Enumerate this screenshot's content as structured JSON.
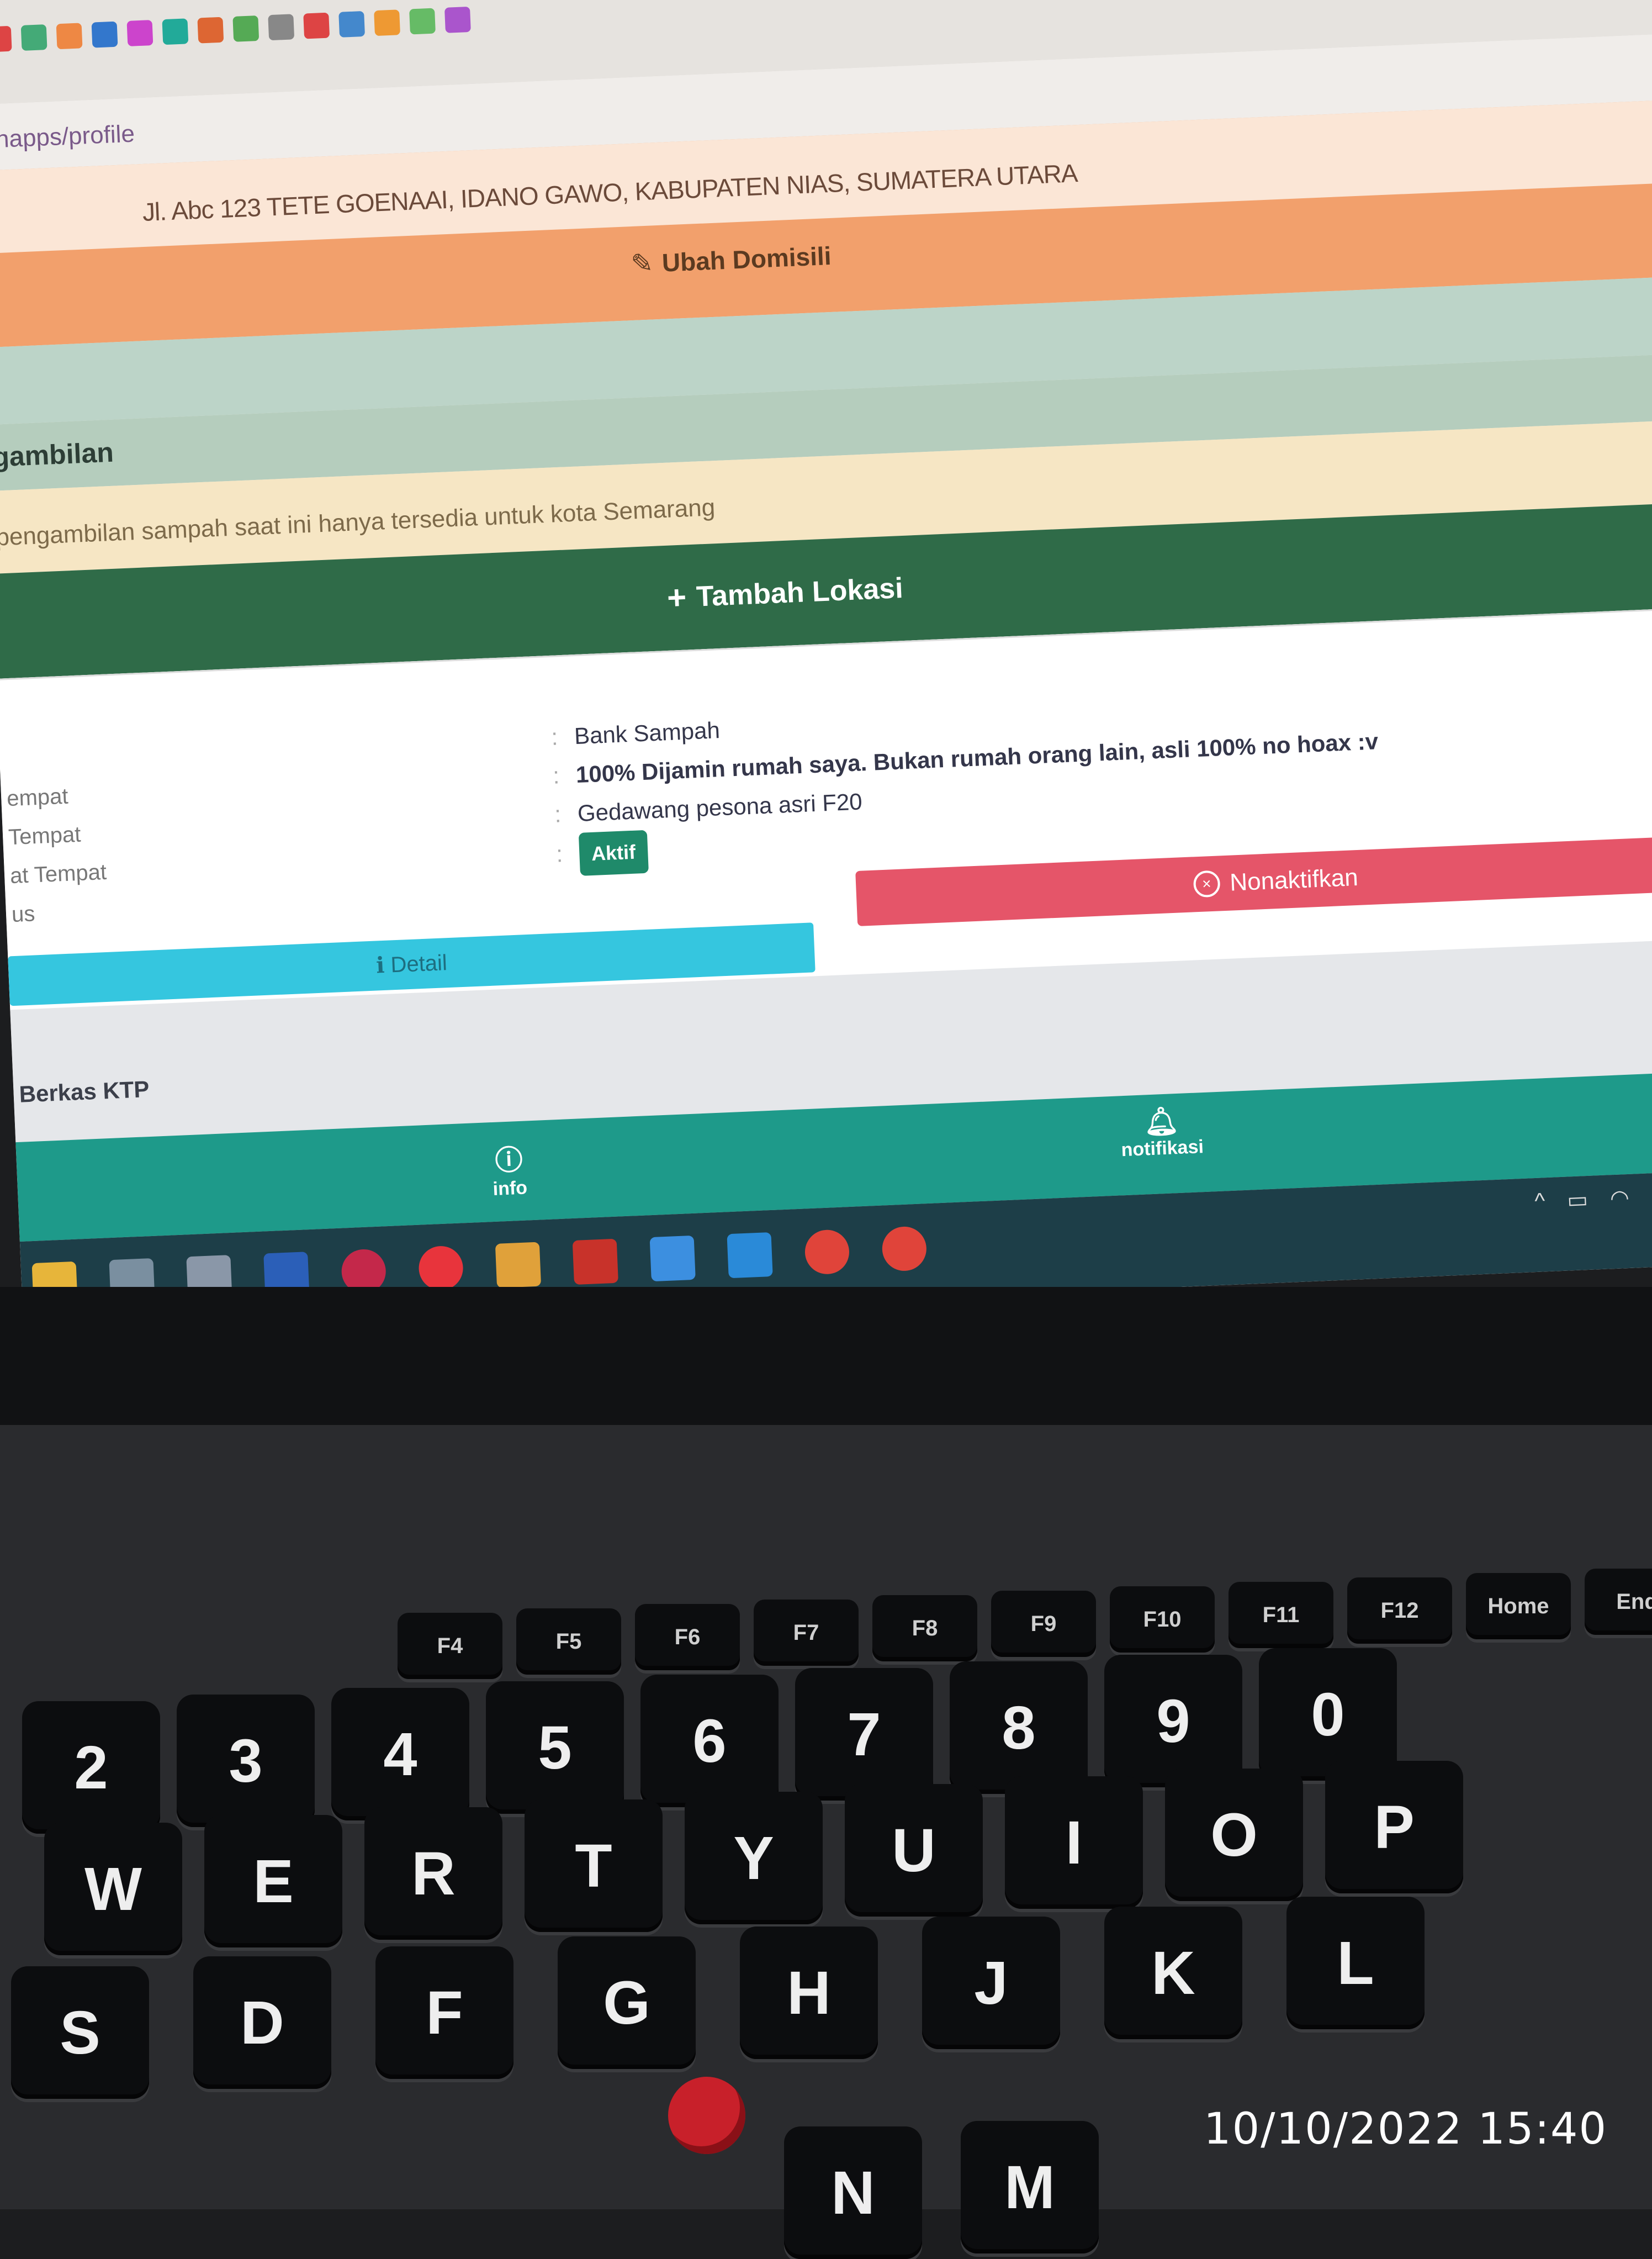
{
  "browser": {
    "address": "inapps/profile"
  },
  "domisili": {
    "address": "Jl. Abc 123 TETE GOENAAI, IDANO GAWO, KABUPATEN NIAS, SUMATERA UTARA",
    "edit_label": "Ubah Domisili"
  },
  "pengambilan": {
    "title": "gambilan",
    "notice": "pengambilan sampah saat ini hanya tersedia untuk kota Semarang",
    "add_label": "Tambah Lokasi"
  },
  "lokasi": {
    "labels": [
      "empat",
      "Tempat",
      "at Tempat",
      "us"
    ],
    "values": {
      "type": "Bank Sampah",
      "description": "100% Dijamin rumah saya. Bukan rumah orang lain, asli 100% no hoax :v",
      "address": "Gedawang pesona asri F20",
      "status": "Aktif"
    },
    "detail_label": "Detail",
    "deactivate_label": "Nonaktifkan"
  },
  "berkas": {
    "title": "Berkas KTP"
  },
  "bottom_nav": {
    "info": "info",
    "notifications": "notifikasi"
  },
  "keyboard": {
    "fn_row": [
      "F4",
      "F5",
      "F6",
      "F7",
      "F8",
      "F9",
      "F10",
      "F11",
      "F12",
      "Home",
      "End"
    ],
    "number_row": [
      "2",
      "3",
      "4",
      "5",
      "6",
      "7",
      "8",
      "9",
      "0"
    ],
    "top_row": [
      "W",
      "E",
      "R",
      "T",
      "Y",
      "U",
      "I",
      "O",
      "P"
    ],
    "home_row": [
      "S",
      "D",
      "F",
      "G",
      "H",
      "J",
      "K",
      "L"
    ],
    "bottom_row": [
      "N",
      "M"
    ]
  },
  "photo_timestamp": "10/10/2022 15:40",
  "colors": {
    "domisili": "#f2a06c",
    "tambah": "#2f6b48",
    "detail": "#35c6df",
    "nonaktif": "#e55569",
    "bottom_nav": "#1e9a8a",
    "aktif_badge": "#1f8a6a"
  }
}
